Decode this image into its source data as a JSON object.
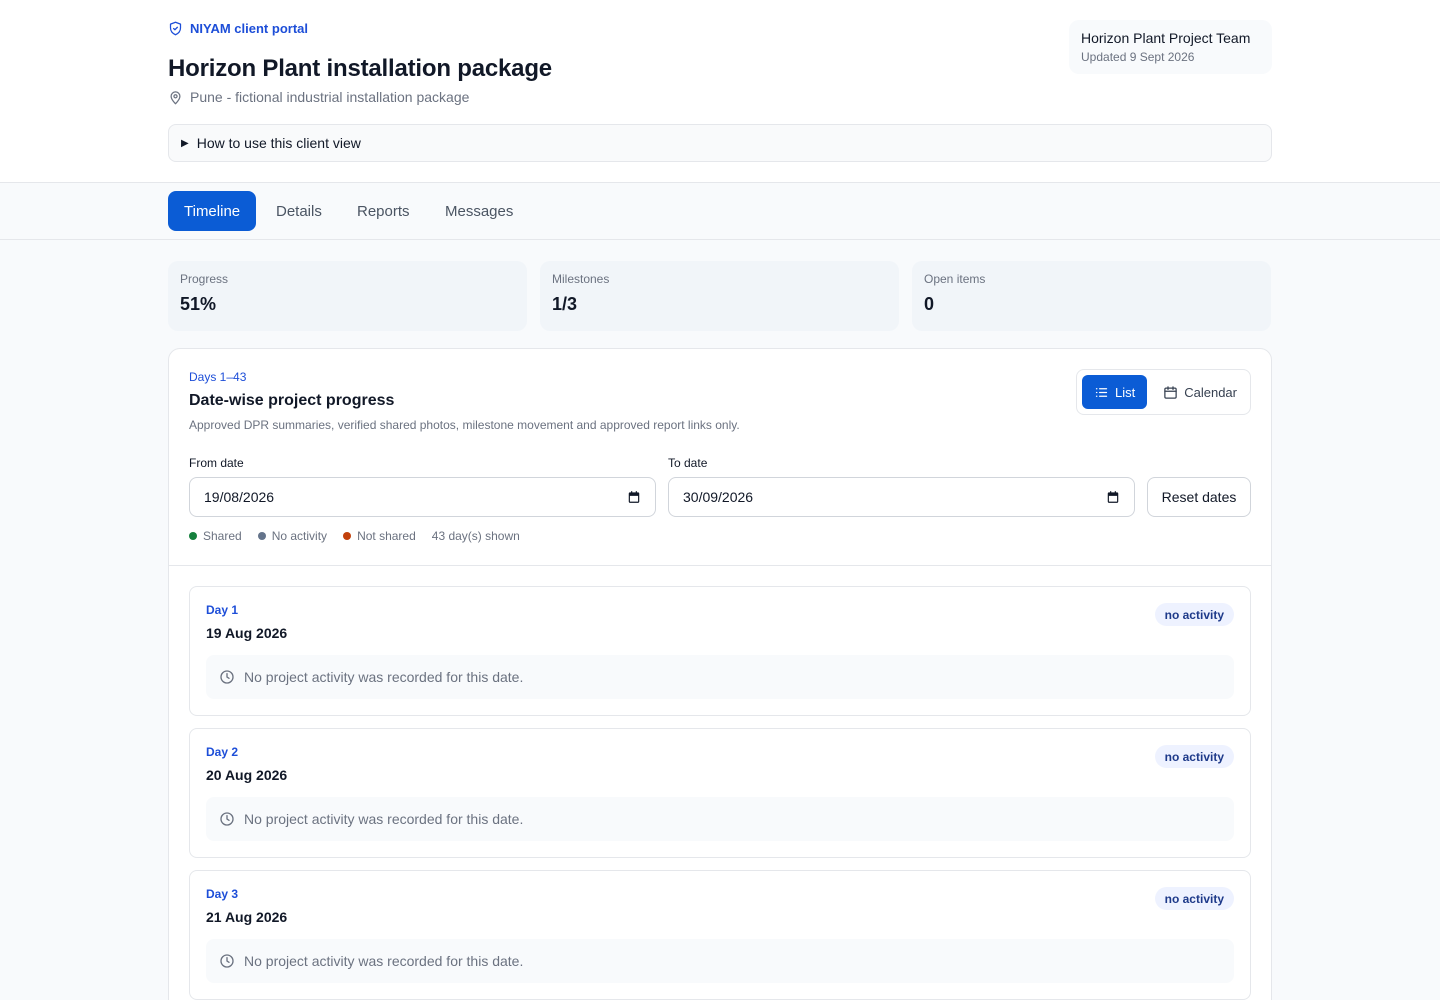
{
  "header": {
    "portal_label": "NIYAM client portal",
    "title": "Horizon Plant installation package",
    "location": "Pune - fictional industrial installation package",
    "team_name": "Horizon Plant Project Team",
    "updated": "Updated 9 Sept 2026",
    "howto": "How to use this client view"
  },
  "tabs": [
    "Timeline",
    "Details",
    "Reports",
    "Messages"
  ],
  "active_tab": "Timeline",
  "stats": [
    {
      "label": "Progress",
      "value": "51%"
    },
    {
      "label": "Milestones",
      "value": "1/3"
    },
    {
      "label": "Open items",
      "value": "0"
    }
  ],
  "panel": {
    "eyebrow": "Days 1–43",
    "title": "Date-wise project progress",
    "description": "Approved DPR summaries, verified shared photos, milestone movement and approved report links only.",
    "view_list": "List",
    "view_calendar": "Calendar",
    "from_label": "From date",
    "from_value": "19/08/2026",
    "to_label": "To date",
    "to_value": "30/09/2026",
    "reset_label": "Reset dates",
    "legend": {
      "shared": "Shared",
      "no_activity": "No activity",
      "not_shared": "Not shared",
      "count": "43 day(s) shown"
    }
  },
  "colors": {
    "accent": "#0b5cd5",
    "shared": "#15803d",
    "no_activity": "#64748b",
    "not_shared": "#c2410c"
  },
  "days": [
    {
      "label": "Day 1",
      "date": "19 Aug 2026",
      "status": "no activity",
      "message": "No project activity was recorded for this date."
    },
    {
      "label": "Day 2",
      "date": "20 Aug 2026",
      "status": "no activity",
      "message": "No project activity was recorded for this date."
    },
    {
      "label": "Day 3",
      "date": "21 Aug 2026",
      "status": "no activity",
      "message": "No project activity was recorded for this date."
    }
  ]
}
